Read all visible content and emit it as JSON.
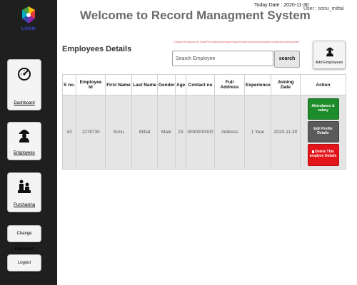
{
  "sidebar": {
    "logo_text": "LOGO",
    "items": [
      {
        "label": "Dashboard",
        "icon": "speedometer-icon"
      },
      {
        "label": "Employees",
        "icon": "worker-icon"
      },
      {
        "label": "Purchasing",
        "icon": "worker-group-icon"
      },
      {
        "label": "Change Password"
      },
      {
        "label": "Logout"
      }
    ]
  },
  "header": {
    "title": "Welcome to Record Managment System",
    "today": "Today Date : 2020-11-30",
    "user": "User : sonu_mittal"
  },
  "section": {
    "heading": "Employees Details",
    "search_hint": "*(Search Employee by Code/First Name/Last Name/Age/Gender/Experience/Contact no/Address/Joining Date)",
    "search_placeholder": "Search Employee",
    "search_button": "search",
    "add_button": "Add Employees"
  },
  "table": {
    "headers": [
      "S no.",
      "Employee Id",
      "First Name",
      "Last Name",
      "Gender",
      "Age",
      "Contact no",
      "Full Address",
      "Experience",
      "Joining Date",
      "Action"
    ],
    "rows": [
      {
        "cells": [
          "43",
          "1278730",
          "Sonu",
          "Mittal",
          "Male",
          "23",
          "0000000000",
          "Address",
          "1 Year",
          "2020-11-30"
        ],
        "actions": {
          "attendance": "Attendance & salary",
          "edit": "Edit Profile Details",
          "delete": "Delete This emplyee Details"
        }
      }
    ]
  },
  "colors": {
    "sidebar_bg": "#1f1f1f",
    "attendance_btn": "#1e8c2b",
    "edit_btn": "#5a5a5a",
    "delete_btn": "#e3151a",
    "hint_text": "#d9534f"
  }
}
